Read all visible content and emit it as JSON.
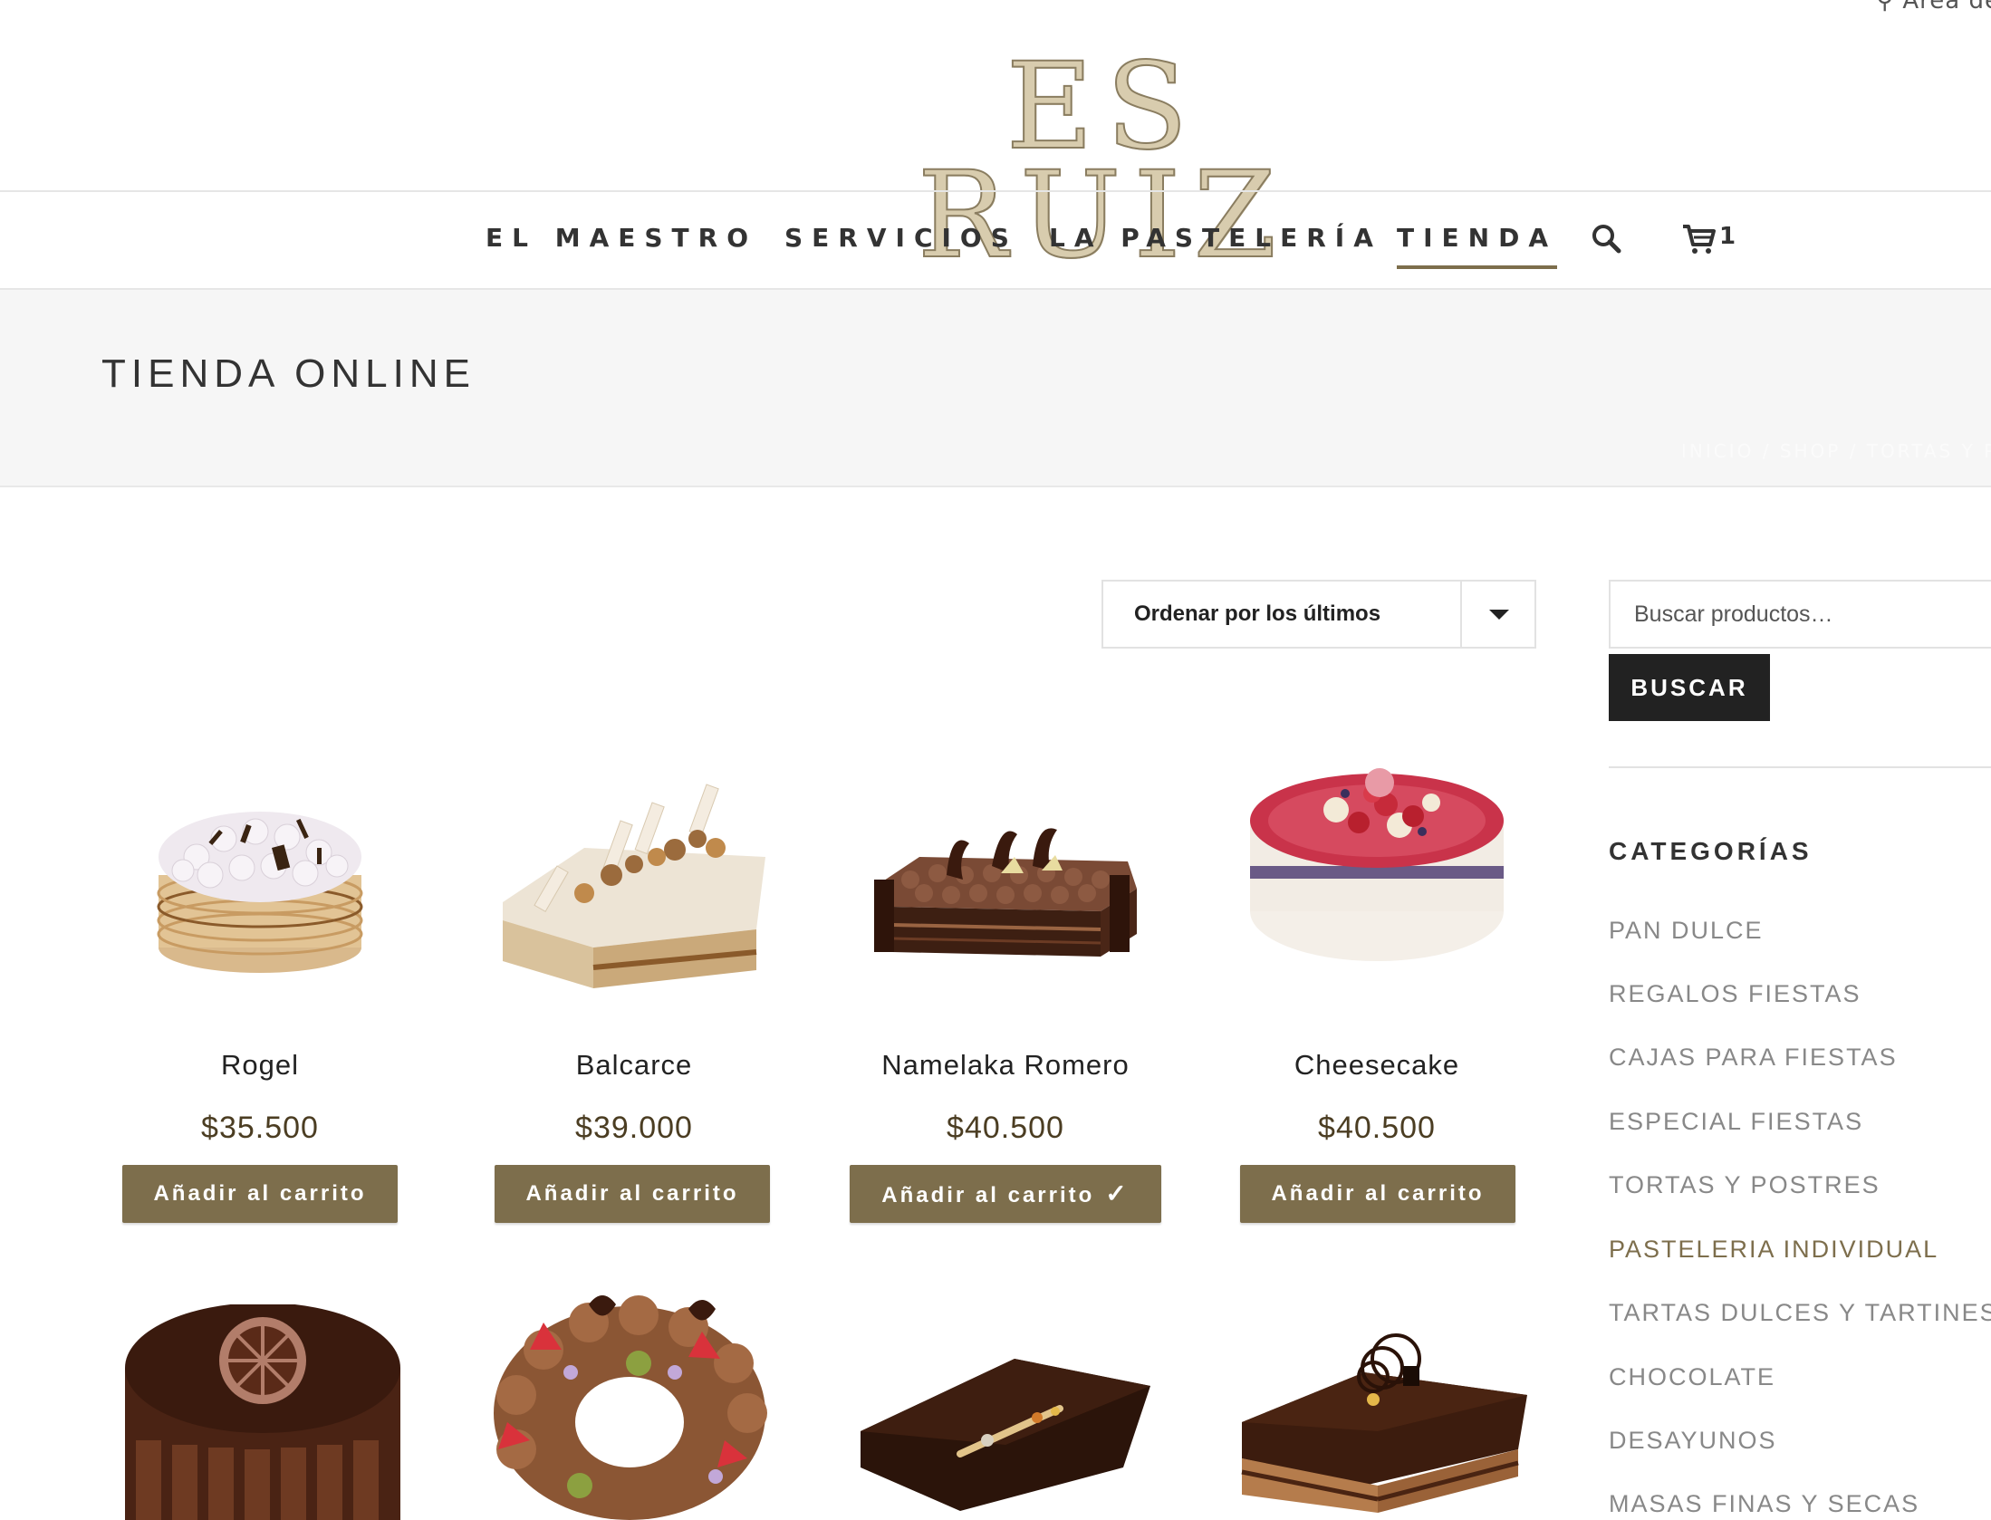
{
  "header": {
    "account_label": "Área de",
    "logo_text": "ES RUIZ"
  },
  "nav": {
    "items": [
      {
        "label": "EL MAESTRO"
      },
      {
        "label": "SERVICIOS"
      },
      {
        "label": "LA PASTELERÍA"
      },
      {
        "label": "TIENDA",
        "active": true
      }
    ],
    "search_icon": "search-icon",
    "cart_icon": "cart-icon",
    "cart_count": "1"
  },
  "hero": {
    "title": "TIENDA ONLINE",
    "breadcrumb": "INICIO / SHOP / TORTAS Y P"
  },
  "sort": {
    "selected": "Ordenar por los últimos"
  },
  "products": [
    {
      "name": "Rogel",
      "price": "$35.500",
      "button": "Añadir al carrito"
    },
    {
      "name": "Balcarce",
      "price": "$39.000",
      "button": "Añadir al carrito"
    },
    {
      "name": "Namelaka Romero",
      "price": "$40.500",
      "button": "Añadir al carrito",
      "added": true
    },
    {
      "name": "Cheesecake",
      "price": "$40.500",
      "button": "Añadir al carrito"
    }
  ],
  "sidebar": {
    "search_placeholder": "Buscar productos…",
    "search_button": "BUSCAR",
    "categories_title": "CATEGORÍAS",
    "categories": [
      {
        "label": "PAN DULCE"
      },
      {
        "label": "REGALOS FIESTAS"
      },
      {
        "label": "CAJAS PARA FIESTAS"
      },
      {
        "label": "ESPECIAL FIESTAS"
      },
      {
        "label": "TORTAS Y POSTRES"
      },
      {
        "label": "PASTELERIA INDIVIDUAL",
        "active": true
      },
      {
        "label": "TARTAS DULCES Y TARTINES"
      },
      {
        "label": "CHOCOLATE"
      },
      {
        "label": "DESAYUNOS"
      },
      {
        "label": "MASAS FINAS Y SECAS"
      }
    ]
  },
  "colors": {
    "accent": "#7d6e4c",
    "price": "#4b3d22",
    "hero_bg": "#f6f6f6",
    "dark_button": "#222222"
  }
}
